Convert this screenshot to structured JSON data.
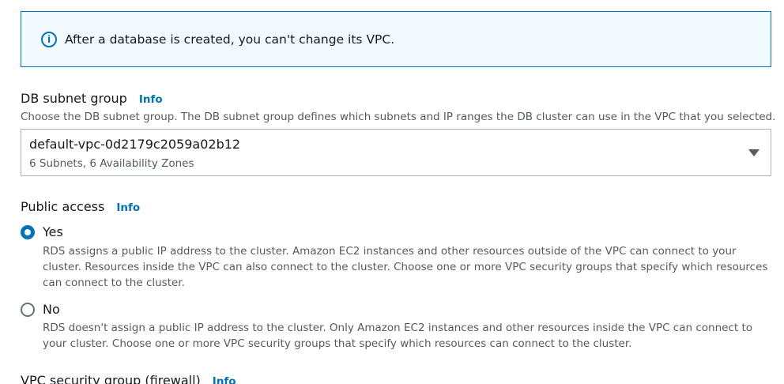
{
  "alert": {
    "icon": "info-icon",
    "text": "After a database is created, you can't change its VPC."
  },
  "subnet_group": {
    "label": "DB subnet group",
    "info": "Info",
    "description": "Choose the DB subnet group. The DB subnet group defines which subnets and IP ranges the DB cluster can use in the VPC that you selected.",
    "value": "default-vpc-0d2179c2059a02b12",
    "subtext": "6 Subnets, 6 Availability Zones"
  },
  "public_access": {
    "label": "Public access",
    "info": "Info",
    "options": [
      {
        "label": "Yes",
        "selected": true,
        "description": "RDS assigns a public IP address to the cluster. Amazon EC2 instances and other resources outside of the VPC can connect to your cluster. Resources inside the VPC can also connect to the cluster. Choose one or more VPC security groups that specify which resources can connect to the cluster."
      },
      {
        "label": "No",
        "selected": false,
        "description": "RDS doesn't assign a public IP address to the cluster. Only Amazon EC2 instances and other resources inside the VPC can connect to your cluster. Choose one or more VPC security groups that specify which resources can connect to the cluster."
      }
    ]
  },
  "security_group": {
    "label": "VPC security group (firewall)",
    "info": "Info"
  },
  "colors": {
    "accent": "#0073bb",
    "alert_bg": "#f1faff",
    "text": "#16191f",
    "muted": "#545b64"
  }
}
